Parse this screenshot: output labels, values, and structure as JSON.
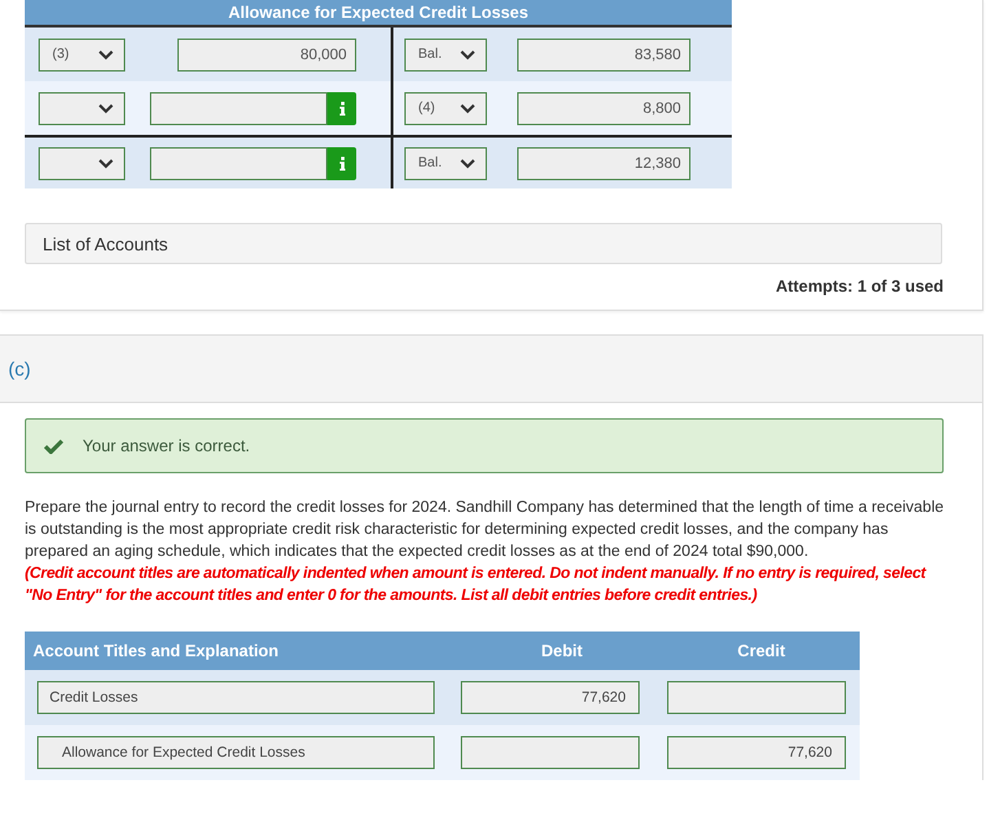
{
  "t_account": {
    "title": "Allowance for Expected Credit Losses",
    "rows": [
      {
        "kind": "entry",
        "left": {
          "ref": "(3)",
          "amount": "80,000",
          "info_button": false
        },
        "right": {
          "ref": "Bal.",
          "amount": "83,580"
        }
      },
      {
        "kind": "entry",
        "left": {
          "info_button": true
        },
        "right": {
          "ref": "(4)",
          "amount": "8,800"
        }
      },
      {
        "kind": "balance",
        "left": {
          "info_button": true
        },
        "right": {
          "ref": "Bal.",
          "amount": "12,380"
        }
      }
    ]
  },
  "list_of_accounts": "List of Accounts",
  "attempts": "Attempts: 1 of 3 used",
  "part": {
    "label": "(c)",
    "feedback": {
      "correct": true,
      "message": "Your answer is correct."
    },
    "instructions": "Prepare the journal entry to record the credit losses for 2024. Sandhill Company has determined that the length of time a receivable is outstanding is the most appropriate credit risk characteristic for determining expected credit losses, and the company has prepared an aging schedule, which indicates that the expected credit losses as at the end of 2024 total $90,000.",
    "note": "(Credit account titles are automatically indented when amount is entered. Do not indent manually. If no entry is required, select \"No Entry\" for the account titles and enter 0 for the amounts. List all debit entries before credit entries.)",
    "journal": {
      "columns": [
        "Account Titles and Explanation",
        "Debit",
        "Credit"
      ],
      "rows": [
        {
          "account": "Credit Losses",
          "indented": false,
          "debit": "77,620"
        },
        {
          "account": "Allowance for Expected Credit Losses",
          "indented": true,
          "credit": "77,620"
        }
      ]
    }
  }
}
